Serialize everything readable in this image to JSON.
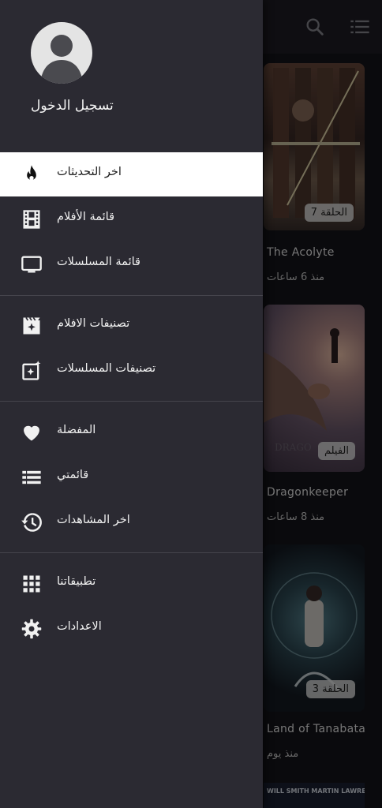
{
  "header": {
    "login_label": "تسجيل الدخول"
  },
  "menu": {
    "latest_updates": "اخر التحديثات",
    "movies_list": "قائمة الأفلام",
    "series_list": "قائمة المسلسلات",
    "movie_categories": "تصنيفات الافلام",
    "series_categories": "تصنيفات المسلسلات",
    "favorites": "المفضلة",
    "my_list": "قائمتي",
    "watch_history": "اخر المشاهدات",
    "our_apps": "تطبيقاتنا",
    "settings": "الاعدادات"
  },
  "cards": [
    {
      "title": "The Acolyte",
      "badge": "الحلقة 7",
      "time": "منذ 6 ساعات"
    },
    {
      "title": "Dragonkeeper",
      "badge": "الفيلم",
      "time": "منذ 8 ساعات"
    },
    {
      "title": "Land of Tanabata",
      "badge": "الحلقة 3",
      "time": "منذ يوم"
    }
  ],
  "poster_text": {
    "dragonkeeper": "DRAGO",
    "bottom_poster": "WILL SMITH   MARTIN LAWRENCE"
  },
  "colors": {
    "drawer_bg": "#2b2a32",
    "active_item_bg": "#ffffff",
    "topbar_bg": "#1e1d24"
  },
  "icons": {
    "search": "search-icon",
    "list": "list-icon",
    "fire": "fire-icon",
    "movie": "movie-icon",
    "tv": "tv-icon",
    "movie_sparkle": "movie-sparkle-icon",
    "sparkle_box": "sparkle-box-icon",
    "heart": "heart-icon",
    "playlist": "playlist-icon",
    "history": "history-icon",
    "apps": "apps-grid-icon",
    "gear": "gear-icon"
  }
}
